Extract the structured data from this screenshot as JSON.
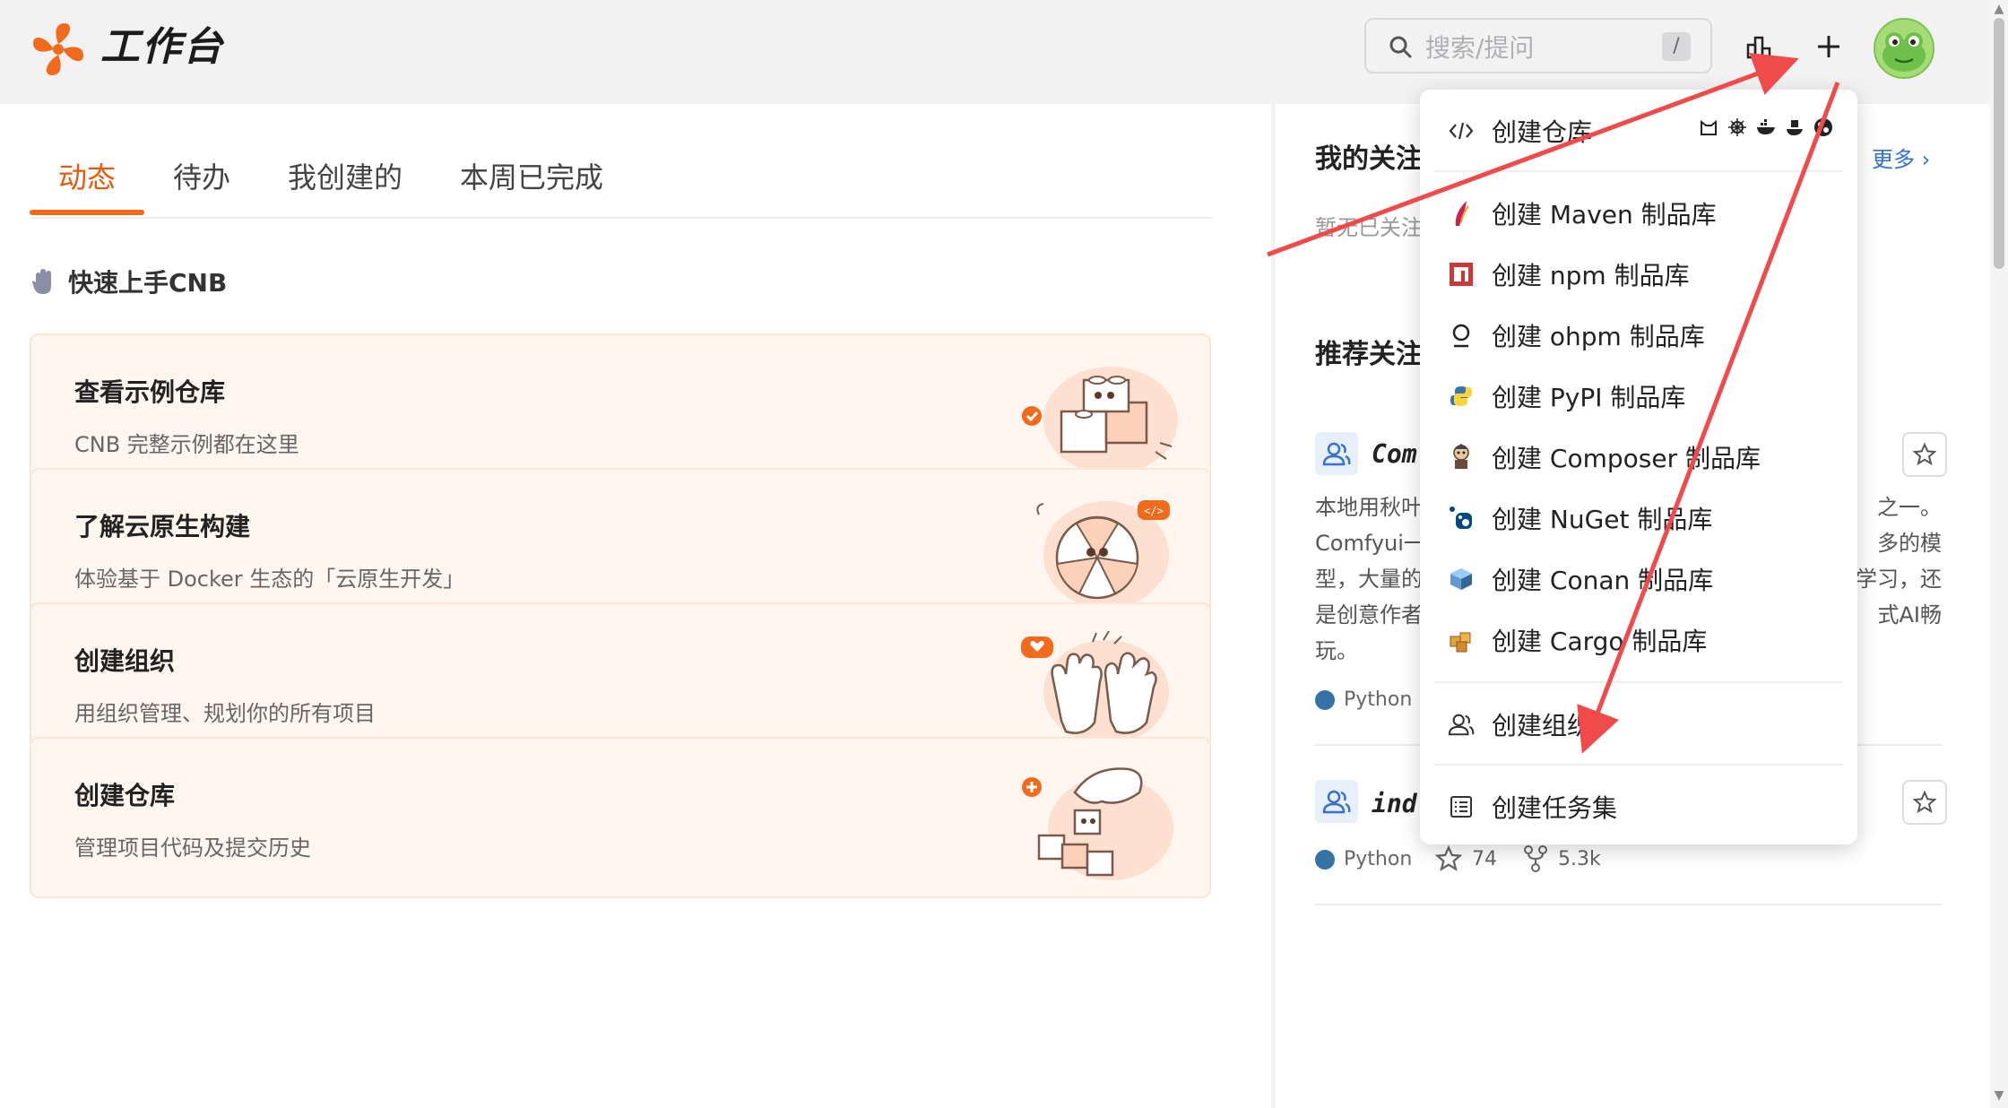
{
  "header": {
    "brand": "工作台",
    "search_placeholder": "搜索/提问",
    "search_shortcut": "/"
  },
  "tabs": [
    {
      "label": "动态",
      "active": true
    },
    {
      "label": "待办"
    },
    {
      "label": "我创建的"
    },
    {
      "label": "本周已完成"
    }
  ],
  "quickstart": {
    "title": "快速上手CNB",
    "cards": [
      {
        "title": "查看示例仓库",
        "desc": "CNB 完整示例都在这里"
      },
      {
        "title": "了解云原生构建",
        "desc": "体验基于 Docker 生态的「云原生开发」"
      },
      {
        "title": "创建组织",
        "desc": "用组织管理、规划你的所有项目"
      },
      {
        "title": "创建仓库",
        "desc": "管理项目代码及提交历史"
      }
    ]
  },
  "right": {
    "following_title": "我的关注",
    "more": "更多",
    "following_empty": "暂无已关注",
    "recommend_title": "推荐关注",
    "repos": [
      {
        "name": "Com",
        "desc_lines": [
          "本地用秋叶",
          "Comfyui一",
          "型，大量的",
          "是创意作者",
          "玩。"
        ],
        "desc_right": [
          "之一。",
          "多的模",
          "学习，还",
          "式AI畅"
        ],
        "lang": "Python"
      },
      {
        "name": "ind",
        "lang": "Python",
        "stars": "74",
        "forks": "5.3k"
      }
    ]
  },
  "dropdown": {
    "items": [
      {
        "label": "创建仓库",
        "icon": "code-icon"
      },
      {
        "label": "创建 Maven 制品库",
        "icon": "maven-icon"
      },
      {
        "label": "创建 npm 制品库",
        "icon": "npm-icon"
      },
      {
        "label": "创建 ohpm 制品库",
        "icon": "ohpm-icon"
      },
      {
        "label": "创建 PyPI 制品库",
        "icon": "pypi-icon"
      },
      {
        "label": "创建 Composer 制品库",
        "icon": "composer-icon"
      },
      {
        "label": "创建 NuGet 制品库",
        "icon": "nuget-icon"
      },
      {
        "label": "创建 Conan 制品库",
        "icon": "conan-icon"
      },
      {
        "label": "创建 Cargo 制品库",
        "icon": "cargo-icon"
      },
      {
        "label": "创建组织",
        "icon": "org-icon"
      },
      {
        "label": "创建任务集",
        "icon": "list-icon"
      }
    ]
  },
  "colors": {
    "accent": "#f26a1b",
    "annotation_red": "#f04a4a",
    "link": "#2e6fd8"
  }
}
